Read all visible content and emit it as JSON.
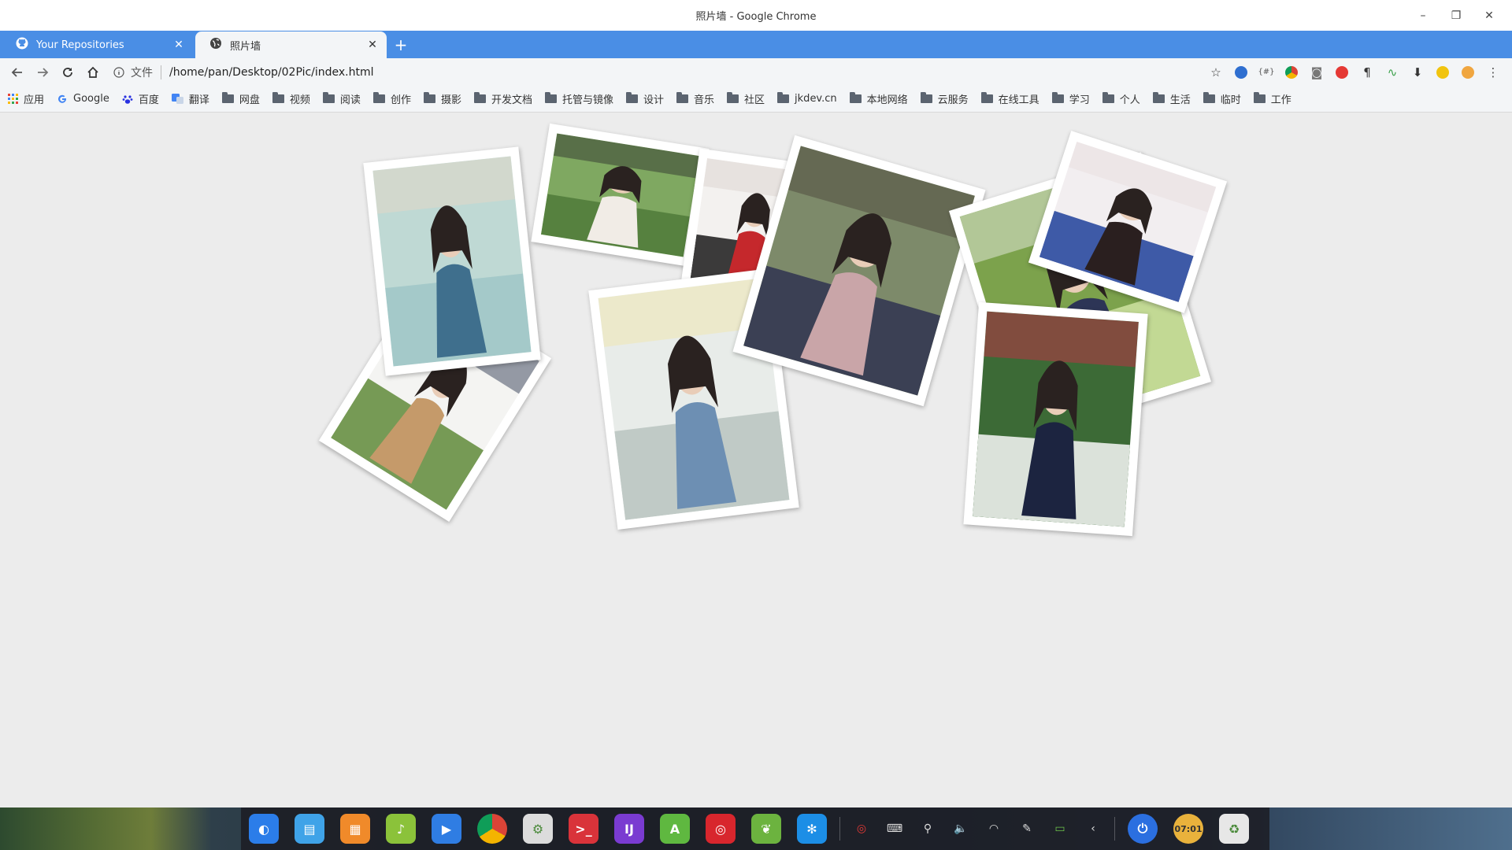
{
  "window": {
    "title": "照片墙 - Google Chrome",
    "controls": {
      "minimize": "–",
      "restore": "❐",
      "close": "✕"
    }
  },
  "tabs": [
    {
      "label": "Your Repositories",
      "icon": "github-icon",
      "active": false
    },
    {
      "label": "照片墙",
      "icon": "globe-icon",
      "active": true
    }
  ],
  "new_tab_label": "+",
  "toolbar": {
    "info_label": "文件",
    "url": "/home/pan/Desktop/02Pic/index.html",
    "extensions": [
      "search-ext-icon",
      "json-ext-icon",
      "chrome-ext-icon",
      "camera-ext-icon",
      "flash-ext-icon",
      "paragraph-ext-icon",
      "pulse-ext-icon",
      "download-ext-icon",
      "translate-ext-icon",
      "emoji-ext-icon"
    ]
  },
  "bookmarks": [
    {
      "label": "应用",
      "icon": "apps-grid-icon"
    },
    {
      "label": "Google",
      "icon": "google-icon"
    },
    {
      "label": "百度",
      "icon": "baidu-icon"
    },
    {
      "label": "翻译",
      "icon": "translate-icon"
    },
    {
      "label": "网盘",
      "icon": "folder-icon"
    },
    {
      "label": "视频",
      "icon": "folder-icon"
    },
    {
      "label": "阅读",
      "icon": "folder-icon"
    },
    {
      "label": "创作",
      "icon": "folder-icon"
    },
    {
      "label": "摄影",
      "icon": "folder-icon"
    },
    {
      "label": "开发文档",
      "icon": "folder-icon"
    },
    {
      "label": "托管与镜像",
      "icon": "folder-icon"
    },
    {
      "label": "设计",
      "icon": "folder-icon"
    },
    {
      "label": "音乐",
      "icon": "folder-icon"
    },
    {
      "label": "社区",
      "icon": "folder-icon"
    },
    {
      "label": "jkdev.cn",
      "icon": "folder-icon"
    },
    {
      "label": "本地网络",
      "icon": "folder-icon"
    },
    {
      "label": "云服务",
      "icon": "folder-icon"
    },
    {
      "label": "在线工具",
      "icon": "folder-icon"
    },
    {
      "label": "学习",
      "icon": "folder-icon"
    },
    {
      "label": "个人",
      "icon": "folder-icon"
    },
    {
      "label": "生活",
      "icon": "folder-icon"
    },
    {
      "label": "临时",
      "icon": "folder-icon"
    },
    {
      "label": "工作",
      "icon": "folder-icon"
    }
  ],
  "photos": [
    {
      "name": "photo-girl-chair",
      "palette": [
        "#f4f4f2",
        "#5f8a3a",
        "#c59a6a",
        "#1f2a44"
      ]
    },
    {
      "name": "photo-girl-overalls",
      "palette": [
        "#bfd9d4",
        "#9fc6c7",
        "#3f6f8d",
        "#e9d8c6"
      ]
    },
    {
      "name": "photo-girl-lawn",
      "palette": [
        "#7fa861",
        "#4f7a3a",
        "#f1ece6",
        "#2b2b2b"
      ]
    },
    {
      "name": "photo-girl-red-scarf",
      "palette": [
        "#f3f1ef",
        "#1a1a1a",
        "#c5282c",
        "#d9d0cb"
      ]
    },
    {
      "name": "photo-girl-corridor",
      "palette": [
        "#e8ece9",
        "#b9c4c0",
        "#6d8fb3",
        "#f1e7a6"
      ]
    },
    {
      "name": "photo-girl-flowers",
      "palette": [
        "#7d8a6a",
        "#2f3350",
        "#c9a5a8",
        "#4a4038"
      ]
    },
    {
      "name": "photo-girl-bushes",
      "palette": [
        "#7ca24c",
        "#cfe3a1",
        "#2d3556",
        "#f4f4f4"
      ]
    },
    {
      "name": "photo-girl-sailor-blue",
      "palette": [
        "#f2eef0",
        "#1f3f9a",
        "#2a1f1f",
        "#e7dcdc"
      ]
    },
    {
      "name": "photo-girl-sailor-red",
      "palette": [
        "#3c6a36",
        "#f7f7f7",
        "#1c2440",
        "#d4284a"
      ]
    }
  ],
  "taskbar": {
    "apps": [
      {
        "name": "launcher-icon",
        "color": "#2b7de9",
        "glyph": "◐"
      },
      {
        "name": "file-manager-icon",
        "color": "#3fa3e8",
        "glyph": "▤"
      },
      {
        "name": "app-store-icon",
        "color": "#f08a2a",
        "glyph": "▦"
      },
      {
        "name": "music-icon",
        "color": "#8bc23a",
        "glyph": "♪"
      },
      {
        "name": "video-icon",
        "color": "#2f7de3",
        "glyph": "▶"
      },
      {
        "name": "chrome-icon",
        "color": "#e8e8e8",
        "glyph": ""
      },
      {
        "name": "settings-icon",
        "color": "#dcdcdc",
        "glyph": "⚙"
      },
      {
        "name": "terminal-icon",
        "color": "#d9333a",
        "glyph": ">_"
      },
      {
        "name": "intellij-icon",
        "color": "#7a3bd1",
        "glyph": "IJ"
      },
      {
        "name": "android-studio-icon",
        "color": "#5fb840",
        "glyph": "A"
      },
      {
        "name": "netease-music-icon",
        "color": "#d8262d",
        "glyph": "◎"
      },
      {
        "name": "spring-icon",
        "color": "#6cb33f",
        "glyph": "❦"
      },
      {
        "name": "vscode-like-icon",
        "color": "#1c8ee6",
        "glyph": "✻"
      }
    ],
    "tray": [
      "netease-tray-icon",
      "keyboard-icon",
      "usb-icon",
      "volume-icon",
      "wifi-icon",
      "pen-icon",
      "battery-icon",
      "chevron-left-icon"
    ],
    "tray_glyphs": [
      "◎",
      "⌨",
      "⚲",
      "🔈",
      "◠",
      "✎",
      "▭",
      "‹"
    ],
    "end": [
      {
        "name": "power-icon",
        "color": "#2b6fe0",
        "glyph": "⏻"
      },
      {
        "name": "clock-icon",
        "color": "#e9b23c",
        "glyph": "07:01"
      },
      {
        "name": "trash-icon",
        "color": "#e7e7e7",
        "glyph": "♻"
      }
    ]
  }
}
